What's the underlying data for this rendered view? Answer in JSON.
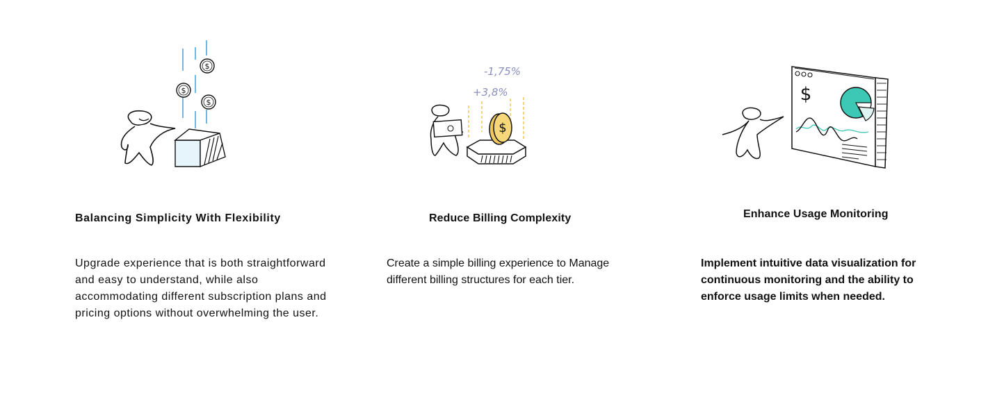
{
  "features": [
    {
      "title": "Balancing Simplicity With Flexibility",
      "body": "Upgrade experience that is both straightforward and easy to understand, while also accommodating different subscription plans and pricing options without overwhelming the user.",
      "illustration": "person-box-falling-coins-icon"
    },
    {
      "title": "Reduce Billing Complexity",
      "body": "Create a simple billing experience to Manage different billing structures for each tier.",
      "illustration": "person-coin-platform-icon",
      "annotations": [
        "-1,75%",
        "+3,8%"
      ]
    },
    {
      "title": "Enhance Usage Monitoring",
      "body": "Implement intuitive data visualization for continuous monitoring and the ability to enforce usage limits when needed.",
      "illustration": "person-dashboard-chart-icon"
    }
  ],
  "colors": {
    "line_blue": "#2a8fd6",
    "coin_yellow": "#f6d77a",
    "chart_teal": "#3cc8b4",
    "annotation_purple": "#8a8fbf",
    "box_tint": "#e6f4fb"
  }
}
